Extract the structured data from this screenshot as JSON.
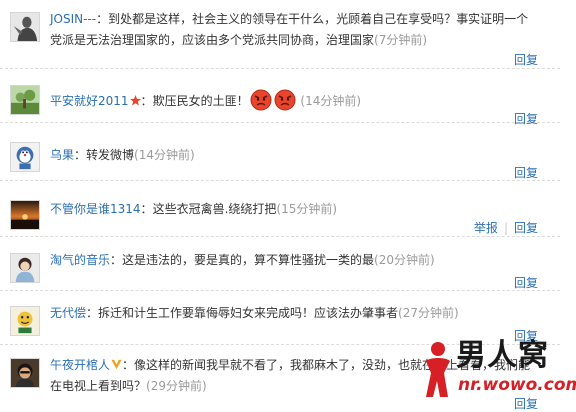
{
  "comments": [
    {
      "user": "JOSIN---",
      "separator": "：",
      "text": "到处都是这样，社会主义的领导在干什么，光顾着自己在享受吗？事实证明一个党派是无法治理国家的，应该由多个党派共同协商，治理国家",
      "time": "(7分钟前)",
      "actions": [
        "回复"
      ]
    },
    {
      "user": "平安就好2011",
      "separator": "：",
      "text": "欺压民女的土匪！",
      "emoticons": [
        "angry-face",
        "angry-face"
      ],
      "time": "(14分钟前)",
      "actions": [
        "回复"
      ]
    },
    {
      "user": "乌果",
      "separator": "：",
      "text": "转发微博",
      "time": "(14分钟前)",
      "actions": [
        "回复"
      ]
    },
    {
      "user": "不管你是谁1314",
      "separator": "：",
      "text": "这些衣冠禽兽.绕绕打把",
      "time": "(15分钟前)",
      "actions": [
        "举报",
        "回复"
      ]
    },
    {
      "user": "淘气的音乐",
      "separator": "：",
      "text": "这是违法的，要是真的，算不算性骚扰一类的最",
      "time": "(20分钟前)",
      "actions": [
        "回复"
      ]
    },
    {
      "user": "无代偿",
      "separator": "：",
      "text": "拆迁和计生工作要靠侮辱妇女来完成吗！应该法办肇事者",
      "time": "(27分钟前)",
      "actions": [
        "回复"
      ]
    },
    {
      "user": "午夜开棺人",
      "separator": "：",
      "text": "像这样的新闻我早就不看了，我都麻木了，没劲，也就在网上看看，我们能在电视上看到吗？",
      "time": "(29分钟前)",
      "actions": [
        "回复"
      ]
    }
  ],
  "watermark": {
    "title": "男人窝",
    "url": "nr.wowo.com"
  },
  "colors": {
    "link": "#2b6fb3",
    "time": "#9a9a9a",
    "text": "#333333",
    "angry_face": "#e8452c",
    "watermark_red": "#d71f26"
  }
}
